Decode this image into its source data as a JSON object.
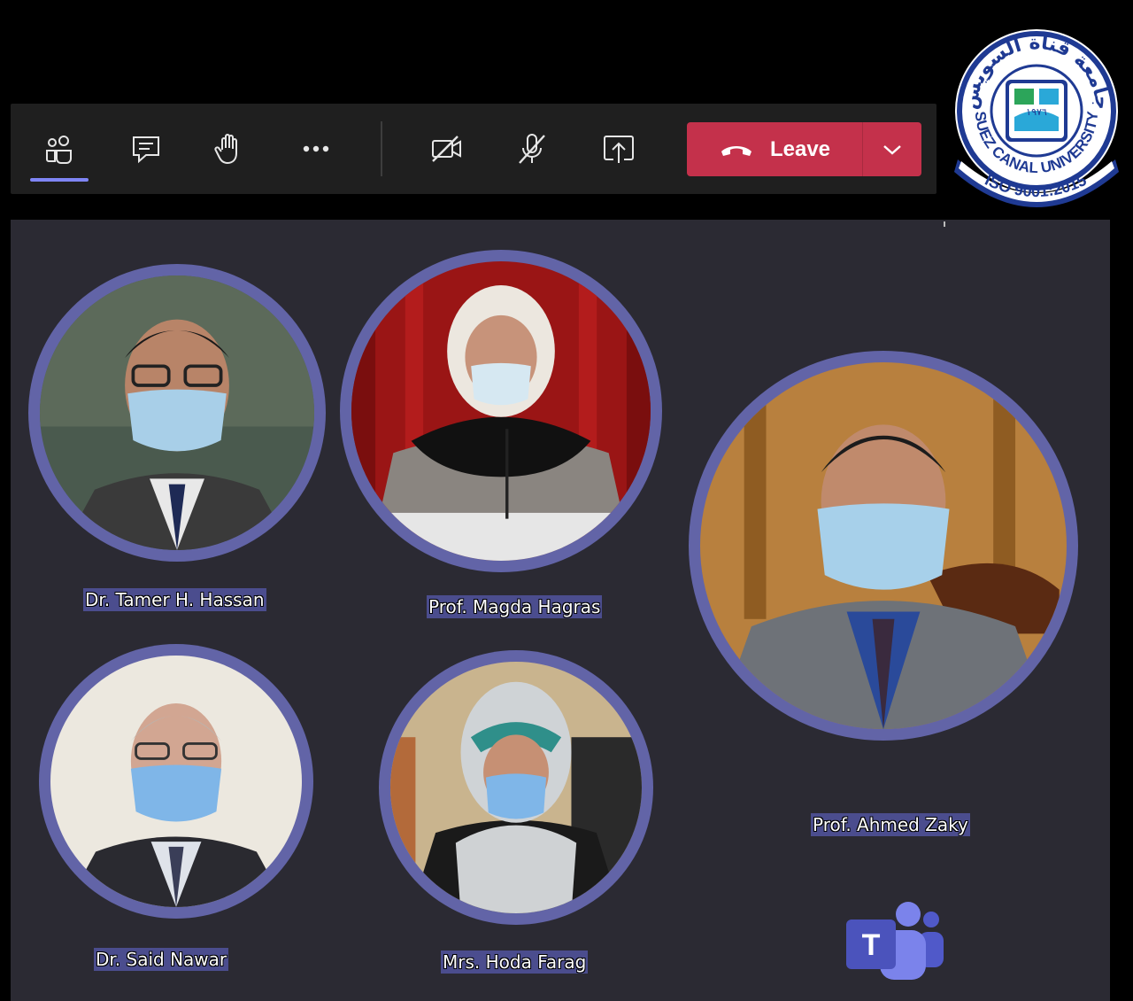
{
  "toolbar": {
    "buttons": [
      {
        "name": "people",
        "icon": "people-icon",
        "active": true
      },
      {
        "name": "chat",
        "icon": "chat-icon"
      },
      {
        "name": "raise-hand",
        "icon": "hand-icon"
      },
      {
        "name": "more",
        "icon": "more-icon"
      },
      {
        "name": "camera",
        "icon": "camera-off-icon"
      },
      {
        "name": "mic",
        "icon": "mic-off-icon"
      },
      {
        "name": "share",
        "icon": "share-icon"
      }
    ],
    "leave_label": "Leave",
    "leave_color": "#c4314b",
    "accent_color": "#7f85f5"
  },
  "logo": {
    "arabic_text": "جامعة قناة السويس",
    "english_text": "SUEZ CANAL UNIVERSITY",
    "iso_text": "ISO 9001:2015",
    "year_text": "١٩٧٦"
  },
  "participants": [
    {
      "name": "Dr. Tamer H. Hassan"
    },
    {
      "name": "Prof. Magda Hagras"
    },
    {
      "name": "Prof. Ahmed Zaky"
    },
    {
      "name": "Dr. Said Nawar"
    },
    {
      "name": "Mrs. Hoda Farag"
    }
  ],
  "colors": {
    "stage_background": "#2b2a33",
    "ring": "#6264a7",
    "name_label": "#4b4d8e"
  },
  "teams_logo": {
    "letter": "T"
  }
}
